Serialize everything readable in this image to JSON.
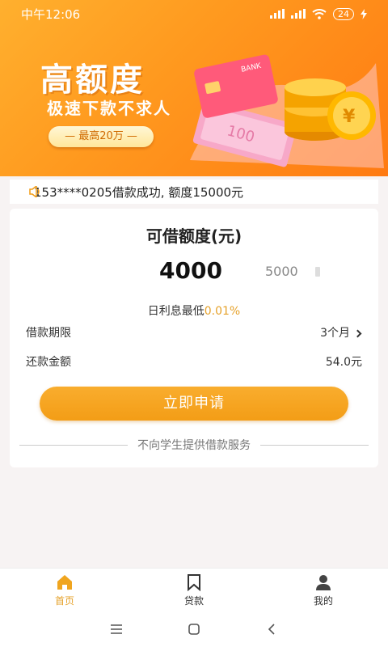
{
  "status_bar": {
    "time": "中午12:06",
    "signal": "HD",
    "battery": "24"
  },
  "banner": {
    "title": "高额度",
    "subtitle": "极速下款不求人",
    "pill": "— 最高20万 —",
    "card_text": "BANK",
    "bill_text": "100"
  },
  "notice": {
    "text": "153****0205借款成功, 额度15000元"
  },
  "loan": {
    "title": "可借额度(元)",
    "amount": "4000",
    "max_amount": "5000",
    "rate_label": "日利息最低",
    "rate_value": "0.01%",
    "term_label": "借款期限",
    "term_value": "3个月",
    "repay_label": "还款金额",
    "repay_value": "54.0元",
    "apply_button": "立即申请",
    "disclaimer": "不向学生提供借款服务"
  },
  "tabs": [
    {
      "label": "首页",
      "icon": "home-icon",
      "active": true
    },
    {
      "label": "贷款",
      "icon": "bookmark-icon",
      "active": false
    },
    {
      "label": "我的",
      "icon": "user-icon",
      "active": false
    }
  ],
  "colors": {
    "accent": "#f39d16",
    "banner": "#ff9a1f",
    "rate": "#e6a22b"
  }
}
